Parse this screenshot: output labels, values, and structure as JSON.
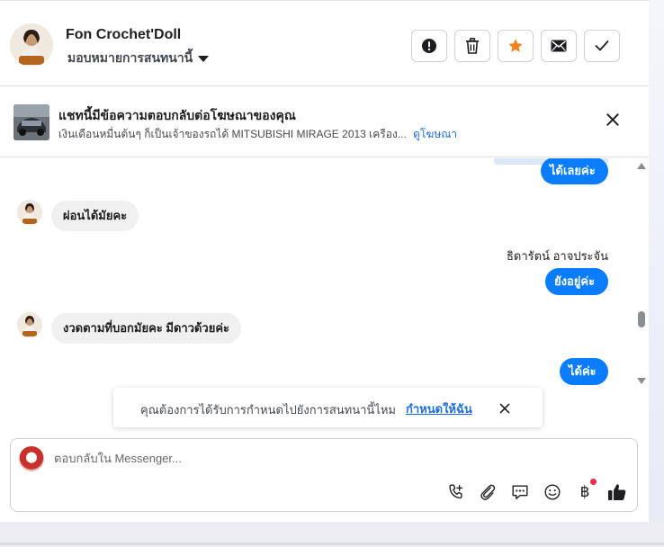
{
  "header": {
    "contact_name": "Fon Crochet'Doll",
    "assign_label": "มอบหมายการสนทนานี้",
    "actions": [
      {
        "name": "report-button",
        "icon": "alert-icon"
      },
      {
        "name": "delete-button",
        "icon": "trash-icon"
      },
      {
        "name": "star-button",
        "icon": "star-icon"
      },
      {
        "name": "mark-unread-button",
        "icon": "envelope-icon"
      },
      {
        "name": "mark-done-button",
        "icon": "check-icon"
      }
    ]
  },
  "ad": {
    "title": "แชทนี้มีข้อความตอบกลับต่อโฆษณาของคุณ",
    "subtitle": "เงินเดือนหมื่นต้นๆ ก็เป็นเจ้าของรถได้ MITSUBISHI MIRAGE 2013 เครือง...",
    "link": "ดูโฆษณา"
  },
  "messages": [
    {
      "direction": "out",
      "text": "ได้เลยค่ะ"
    },
    {
      "direction": "in",
      "text": "ผ่อนได้มัยคะ"
    },
    {
      "direction": "out",
      "sender": "ธิดารัตน์ อาจประจัน",
      "text": "ยังอยู่ค่ะ"
    },
    {
      "direction": "in",
      "text": "งวดตามที่บอกมัยคะ มีดาวด้วยค่ะ"
    },
    {
      "direction": "out",
      "text": "ได้ค่ะ"
    }
  ],
  "reminder": {
    "text": "คุณต้องการได้รับการกำหนดไปยังการสนทนานี้ไหม",
    "link": "กำหนดให้ฉัน"
  },
  "composer": {
    "placeholder": "ตอบกลับใน Messenger...",
    "icons": [
      "call-icon",
      "attachment-icon",
      "saved-replies-icon",
      "emoji-icon",
      "payment-icon",
      "like-icon"
    ],
    "payment_symbol": "฿"
  },
  "colors": {
    "accent": "#0a7cff",
    "link": "#216fdb",
    "star": "#f5821f",
    "notification": "#f02849"
  }
}
